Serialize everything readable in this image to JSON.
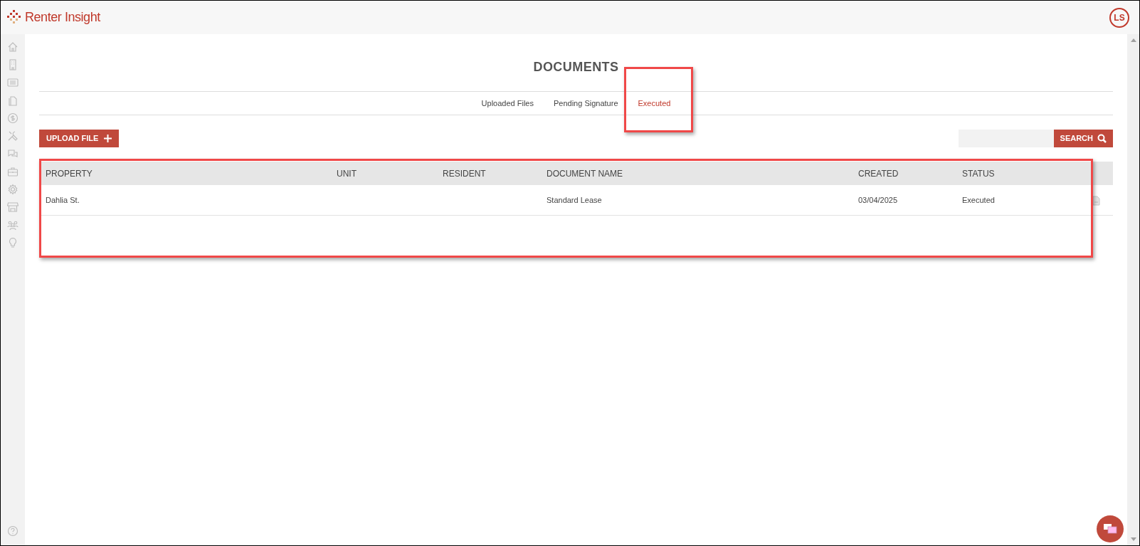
{
  "header": {
    "logo_text": "Renter Insight",
    "avatar": "LS"
  },
  "sidebar": {
    "items": [
      {
        "kind": "home"
      },
      {
        "kind": "building"
      },
      {
        "kind": "list"
      },
      {
        "kind": "files"
      },
      {
        "kind": "dollar"
      },
      {
        "kind": "tools"
      },
      {
        "kind": "chat"
      },
      {
        "kind": "briefcase"
      },
      {
        "kind": "gear"
      },
      {
        "kind": "store"
      },
      {
        "kind": "people"
      },
      {
        "kind": "bulb"
      }
    ],
    "help": {
      "kind": "help"
    }
  },
  "page": {
    "title": "DOCUMENTS",
    "tabs": [
      {
        "label": "Uploaded Files",
        "selected": false,
        "highlighted": false
      },
      {
        "label": "Pending Signature",
        "selected": false,
        "highlighted": false
      },
      {
        "label": "Executed",
        "selected": true,
        "highlighted": true
      }
    ],
    "upload_button": "UPLOAD FILE",
    "search_button": "SEARCH",
    "table": {
      "highlighted": true,
      "columns": [
        "PROPERTY",
        "UNIT",
        "RESIDENT",
        "DOCUMENT NAME",
        "CREATED",
        "STATUS"
      ],
      "rows": [
        {
          "cells": [
            "Dahlia St.",
            "",
            "",
            "Standard Lease",
            "03/04/2025",
            "Executed"
          ]
        }
      ]
    }
  }
}
